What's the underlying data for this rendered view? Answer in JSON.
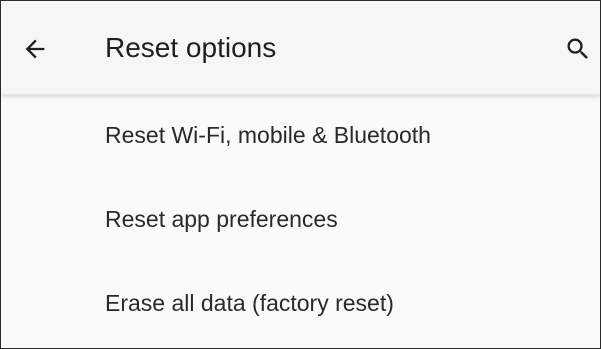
{
  "app_bar": {
    "back_icon": "arrow-back-icon",
    "title": "Reset options",
    "search_icon": "search-icon"
  },
  "options": [
    {
      "label": "Reset Wi-Fi, mobile & Bluetooth"
    },
    {
      "label": "Reset app preferences"
    },
    {
      "label": "Erase all data (factory reset)"
    }
  ]
}
